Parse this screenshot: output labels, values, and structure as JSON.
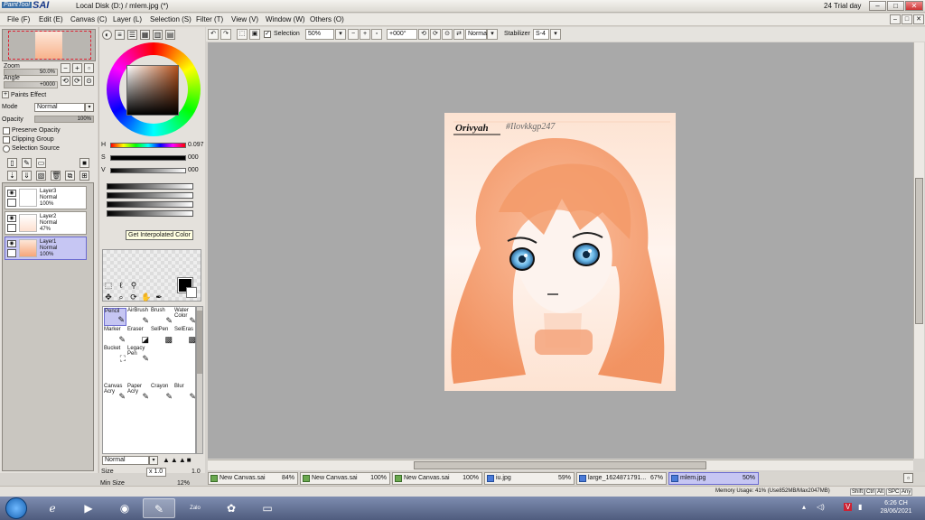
{
  "window": {
    "logo_prefix": "PaintTool",
    "logo_name": "SAI",
    "document_title": "Local Disk (D:) / mlem.jpg (*)",
    "trial_text": "24 Trial day",
    "minimize": "–",
    "maximize": "□",
    "close": "✕"
  },
  "menu": {
    "items": [
      "File (F)",
      "Edit (E)",
      "Canvas (C)",
      "Layer (L)",
      "Selection (S)",
      "Filter (T)",
      "View (V)",
      "Window (W)",
      "Others (O)"
    ]
  },
  "toolbar": {
    "selection_label": "Selection",
    "zoom_value": "50%",
    "angle_value": "+000°",
    "blend_value": "Normal",
    "stabilizer_label": "Stabilizer",
    "stabilizer_value": "S-4"
  },
  "navigator": {
    "zoom_label": "Zoom",
    "zoom_value": "50.0%",
    "angle_label": "Angle",
    "angle_value": "+0000"
  },
  "layer_panel": {
    "paint_effect_label": "Paints Effect",
    "mode_label": "Mode",
    "mode_value": "Normal",
    "opacity_label": "Opacity",
    "opacity_value": "100%",
    "preserve_opacity": "Preserve Opacity",
    "clipping_group": "Clipping Group",
    "selection_source": "Selection Source",
    "layers": [
      {
        "name": "Layer3",
        "mode": "Normal",
        "opacity": "100%"
      },
      {
        "name": "Layer2",
        "mode": "Normal",
        "opacity": "47%"
      },
      {
        "name": "Layer1",
        "mode": "Normal",
        "opacity": "100%"
      }
    ]
  },
  "color_panel": {
    "h_label": "H",
    "h_value": "0.097",
    "s_label": "S",
    "s_value": "000",
    "v_label": "V",
    "v_value": "000",
    "tooltip": "Get Interpolated Color",
    "foreground_color": "#000000",
    "background_color": "#ffffff"
  },
  "brushes": {
    "items": [
      "Pencil",
      "AirBrush",
      "Brush",
      "Water Color",
      "Marker",
      "Eraser",
      "SelPen",
      "SelEras",
      "Bucket",
      "Legacy Pen",
      "Canvas Acry",
      "Paper Acry",
      "Crayon",
      "Blur"
    ],
    "blend_value": "Normal",
    "size_label": "Size",
    "size_multiplier": "x 1.0",
    "size_value": "1.0",
    "min_size_label": "Min Size",
    "min_size_value": "12%"
  },
  "artwork": {
    "signature": "Orivyah",
    "hashtag": "#Ilovkkgp247"
  },
  "tabs": [
    {
      "name": "New Canvas.sai",
      "zoom": "84%"
    },
    {
      "name": "New Canvas.sai",
      "zoom": "100%"
    },
    {
      "name": "New Canvas.sai",
      "zoom": "100%"
    },
    {
      "name": "iu.jpg",
      "zoom": "59%"
    },
    {
      "name": "large_1624871791...",
      "zoom": "67%"
    },
    {
      "name": "mlem.jpg",
      "zoom": "50%"
    }
  ],
  "status": {
    "memory": "Memory Usage: 41% (Use852MB/Max2047MB)",
    "keys": [
      "Shift",
      "Ctrl",
      "Alt",
      "SPC",
      "Any"
    ]
  },
  "taskbar": {
    "time": "6:26 CH",
    "date": "28/06/2021",
    "zalo_label": "Zalo"
  }
}
